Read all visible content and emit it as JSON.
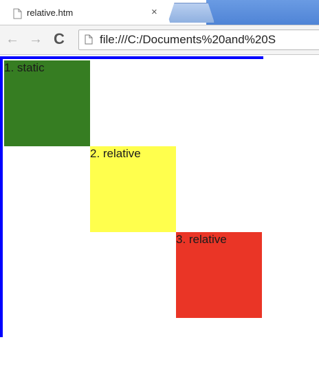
{
  "tab": {
    "title": "relative.htm",
    "close_glyph": "×"
  },
  "toolbar": {
    "back_glyph": "←",
    "forward_glyph": "→",
    "reload_glyph": "C",
    "url": "file:///C:/Documents%20and%20S"
  },
  "boxes": [
    {
      "label": "1. static",
      "color": "#367d22"
    },
    {
      "label": "2. relative",
      "color": "#ffff4d"
    },
    {
      "label": "3. relative",
      "color": "#ea3526"
    }
  ],
  "colors": {
    "container_border": "#0000ff",
    "tab_strip": "#5b8ddb"
  },
  "icons": {
    "tab_favicon": "page-icon",
    "omnibox_icon": "page-icon"
  }
}
